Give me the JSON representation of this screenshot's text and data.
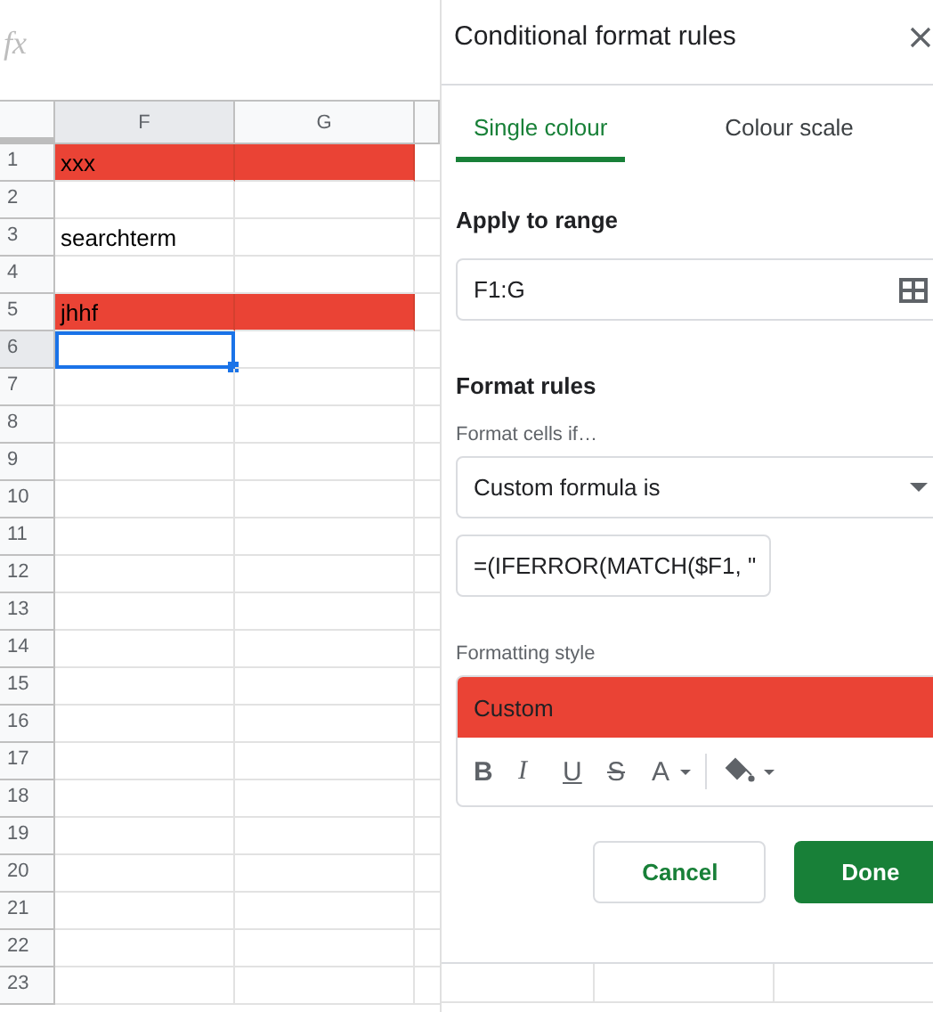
{
  "formula_bar": {
    "label": "fx"
  },
  "sheet": {
    "columns": [
      {
        "label": "F",
        "selected": true
      },
      {
        "label": "G",
        "selected": false
      }
    ],
    "rows": [
      {
        "header": "1",
        "f": "xxx",
        "highlighted": true,
        "selected": false
      },
      {
        "header": "2",
        "highlighted": false,
        "selected": false
      },
      {
        "header": "3",
        "f": "searchterm",
        "highlighted": false,
        "selected": false
      },
      {
        "header": "4",
        "highlighted": false,
        "selected": false
      },
      {
        "header": "5",
        "f": "jhhf",
        "highlighted": true,
        "selected": false
      },
      {
        "header": "6",
        "highlighted": false,
        "selected": true
      },
      {
        "header": "7",
        "highlighted": false,
        "selected": false
      },
      {
        "header": "8",
        "highlighted": false,
        "selected": false
      },
      {
        "header": "9",
        "highlighted": false,
        "selected": false
      },
      {
        "header": "10",
        "highlighted": false,
        "selected": false
      },
      {
        "header": "11",
        "highlighted": false,
        "selected": false
      },
      {
        "header": "12",
        "highlighted": false,
        "selected": false
      },
      {
        "header": "13",
        "highlighted": false,
        "selected": false
      },
      {
        "header": "14",
        "highlighted": false,
        "selected": false
      },
      {
        "header": "15",
        "highlighted": false,
        "selected": false
      },
      {
        "header": "16",
        "highlighted": false,
        "selected": false
      },
      {
        "header": "17",
        "highlighted": false,
        "selected": false
      },
      {
        "header": "18",
        "highlighted": false,
        "selected": false
      },
      {
        "header": "19",
        "highlighted": false,
        "selected": false
      },
      {
        "header": "20",
        "highlighted": false,
        "selected": false
      },
      {
        "header": "21",
        "highlighted": false,
        "selected": false
      },
      {
        "header": "22",
        "highlighted": false,
        "selected": false
      },
      {
        "header": "23",
        "highlighted": false,
        "selected": false
      }
    ]
  },
  "panel": {
    "title": "Conditional format rules",
    "tabs": [
      {
        "label": "Single colour",
        "selected": true
      },
      {
        "label": "Colour scale",
        "selected": false
      }
    ],
    "apply_heading": "Apply to range",
    "range": "F1:G",
    "rules_heading": "Format rules",
    "condition_label": "Format cells if…",
    "condition": "Custom formula is",
    "formula": "=(IFERROR(MATCH($F1, \"",
    "style_label": "Formatting style",
    "style_preview": "Custom",
    "toolbar": [
      {
        "kind": "bold",
        "label": "B"
      },
      {
        "kind": "italic",
        "label": "I"
      },
      {
        "kind": "underline",
        "label": "U"
      },
      {
        "kind": "strike",
        "label": "S"
      },
      {
        "kind": "text-color",
        "label": "A"
      },
      {
        "kind": "fill-color"
      }
    ],
    "buttons": [
      {
        "kind": "secondary",
        "label": "Cancel"
      },
      {
        "kind": "primary",
        "label": "Done"
      }
    ]
  }
}
